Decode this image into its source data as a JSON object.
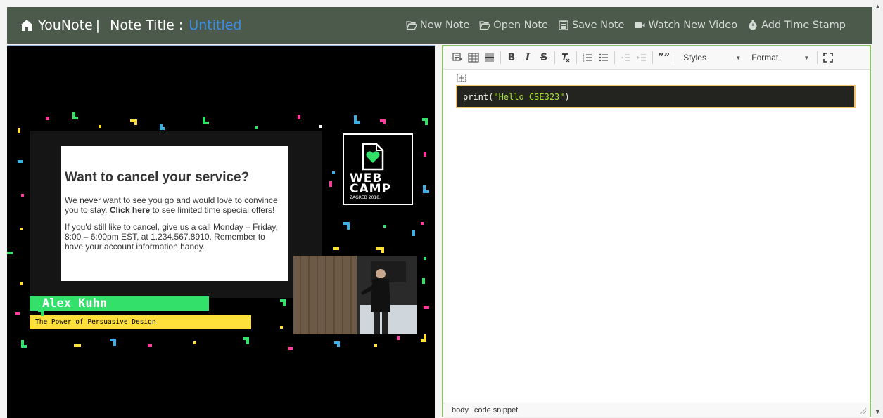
{
  "app": {
    "brand": "YouNote",
    "brand_sep": "|",
    "note_title_label": "Note Title :",
    "note_title_value": "Untitled"
  },
  "nav": {
    "new_note": "New Note",
    "open_note": "Open Note",
    "save_note": "Save Note",
    "watch_new_video": "Watch New Video",
    "add_time_stamp": "Add Time Stamp"
  },
  "icons": [
    "home-icon",
    "folder-open-icon",
    "save-icon",
    "video-camera-icon",
    "stopwatch-icon"
  ],
  "video": {
    "slide": {
      "heading": "Want to cancel your service?",
      "p1_before": "We never want to see you go and would love to convince you to stay. ",
      "p1_link": "Click here",
      "p1_after": " to see limited time special offers!",
      "p2": "If you'd still like to cancel, give us a call Monday – Friday, 8:00 – 6:00pm EST, at 1.234.567.8910. Remember to have your account information handy."
    },
    "logo": {
      "line1": "WEB",
      "line2": "CAMP",
      "line3": "ZAGREB 2018."
    },
    "speaker_name": "Alex Kuhn",
    "talk_title": "The Power of Persuasive Design"
  },
  "editor": {
    "toolbar": {
      "bold": "B",
      "italic": "I",
      "strike": "S",
      "blockquote": "””",
      "styles": "Styles",
      "format": "Format"
    },
    "code": {
      "fn": "print(",
      "str": "\"Hello CSE323\"",
      "end": ")"
    },
    "status_path": [
      "body",
      "code snippet"
    ]
  },
  "colors": {
    "navbar": "#4b5a4a",
    "title_value": "#3a8ee6",
    "editor_border": "#8fc16a",
    "code_bg": "#23241f",
    "code_border": "#f0c36d",
    "speaker_bar": "#32e06a",
    "talk_bar": "#ffe03a"
  }
}
